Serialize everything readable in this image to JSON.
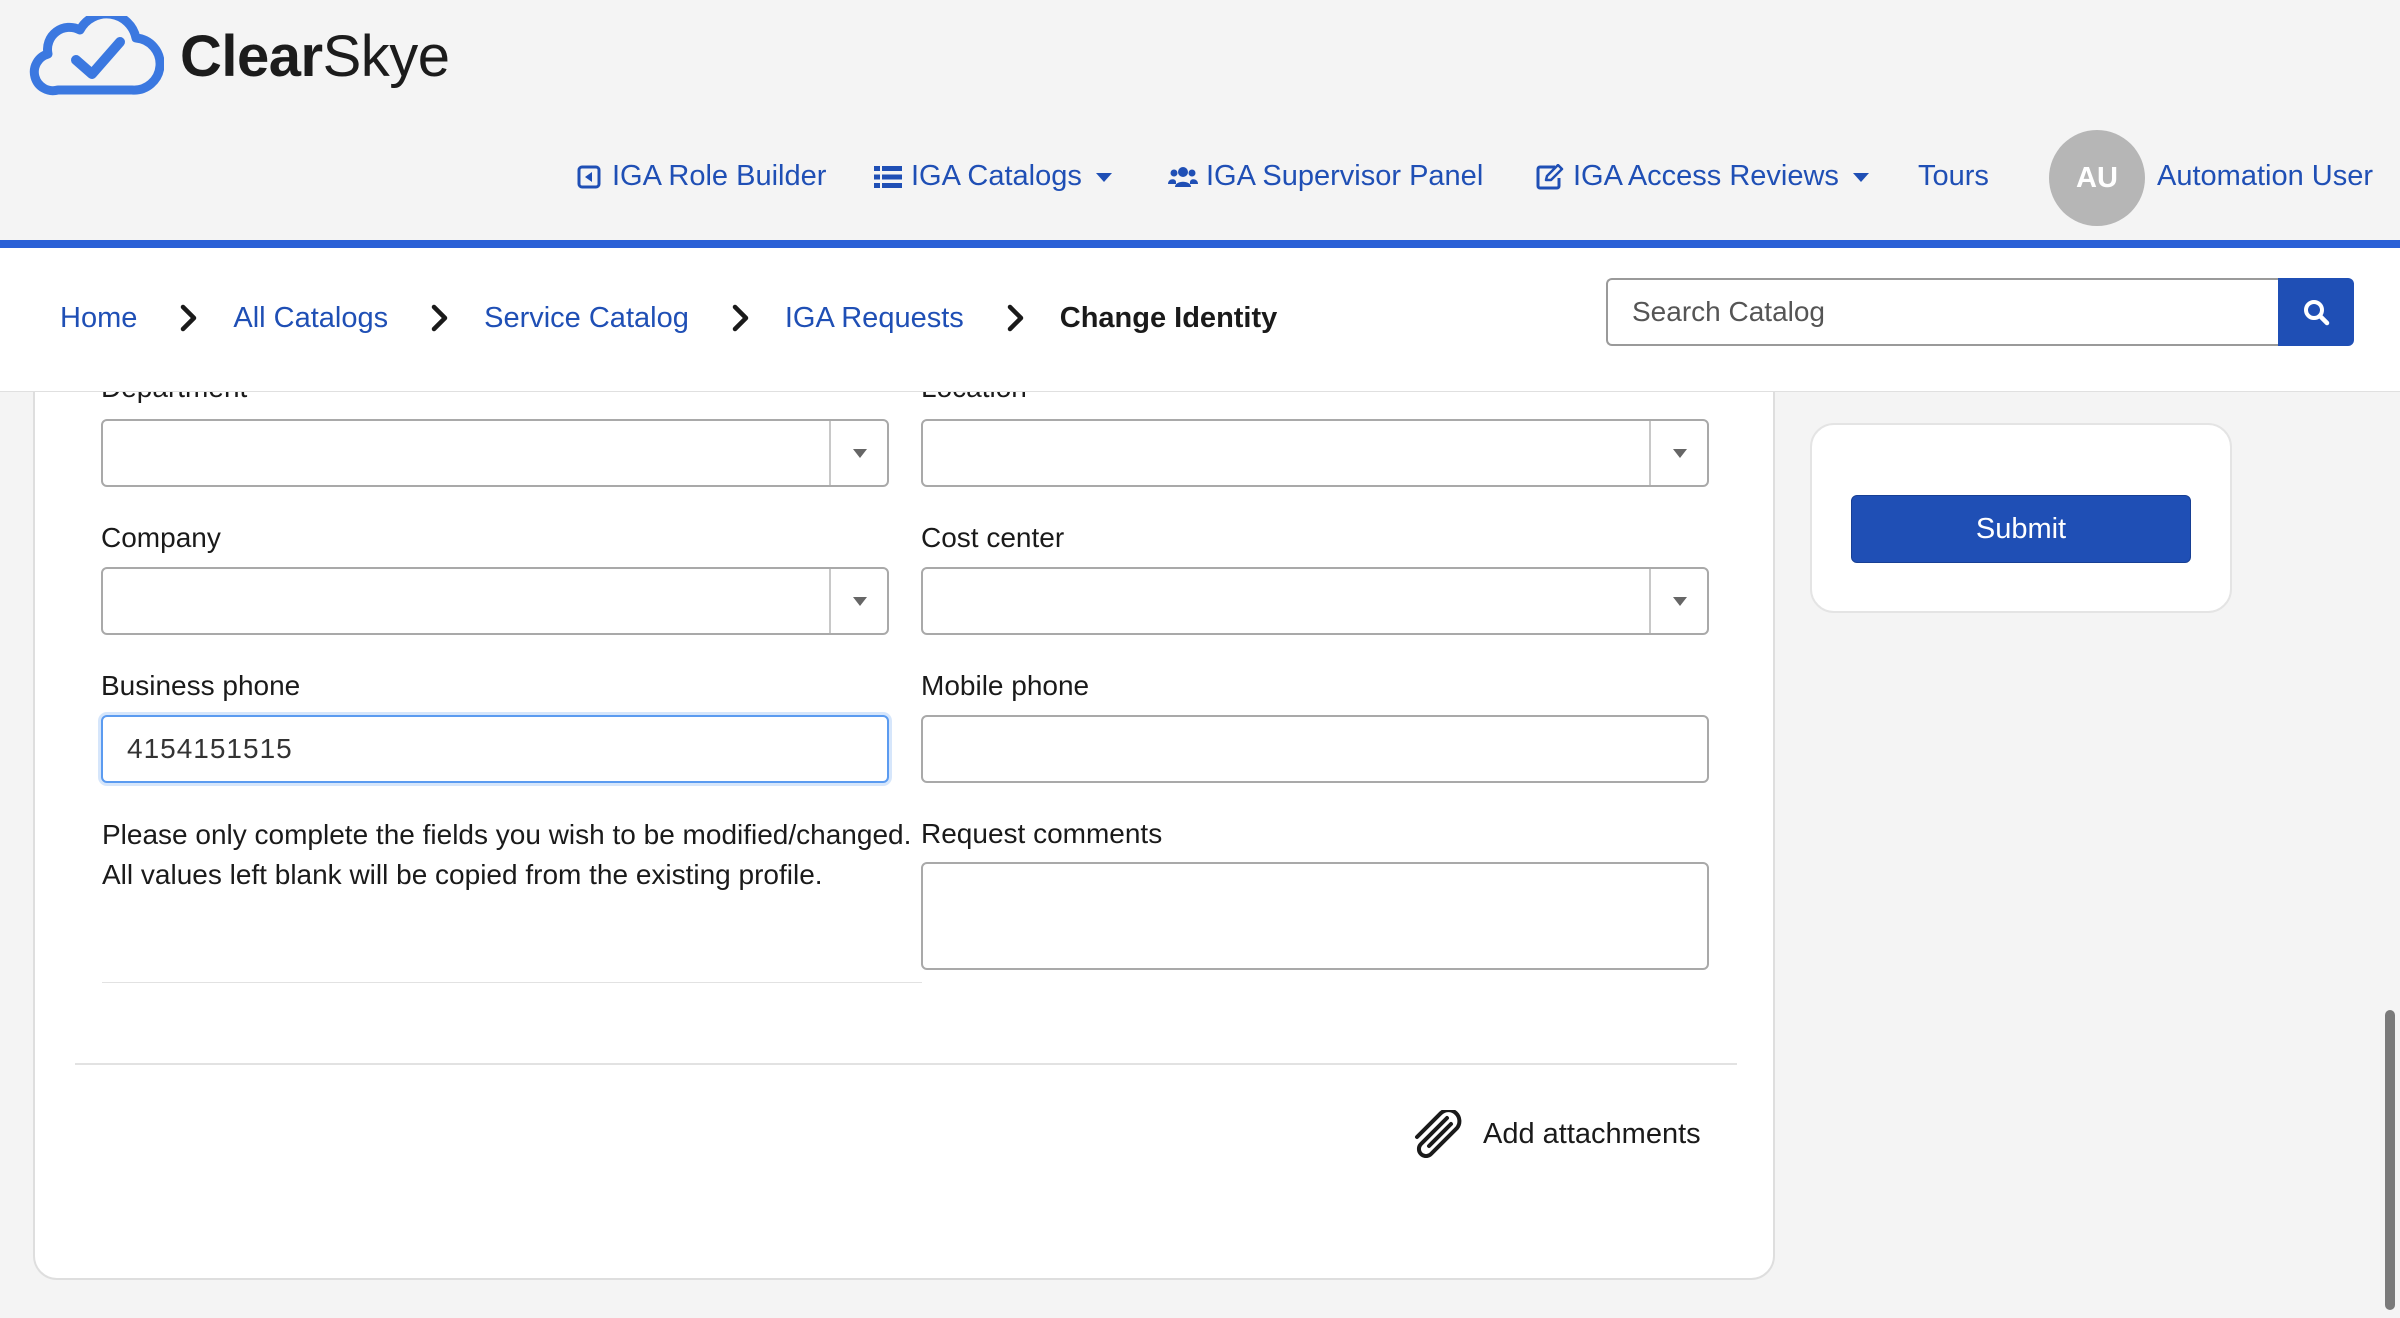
{
  "brand": {
    "name_bold": "Clear",
    "name_light": "Skye",
    "accent_color": "#2a60d6",
    "link_color": "#1f4fb5"
  },
  "nav": {
    "role_builder": {
      "label": "IGA Role Builder",
      "icon": "caret-square-left-icon"
    },
    "catalogs": {
      "label": "IGA Catalogs",
      "icon": "list-icon"
    },
    "supervisor": {
      "label": "IGA Supervisor Panel",
      "icon": "users-icon"
    },
    "access_reviews": {
      "label": "IGA Access Reviews",
      "icon": "edit-icon"
    },
    "tours": {
      "label": "Tours"
    },
    "user": {
      "initials": "AU",
      "name": "Automation User"
    }
  },
  "breadcrumb": {
    "items": [
      "Home",
      "All Catalogs",
      "Service Catalog",
      "IGA Requests"
    ],
    "current": "Change Identity"
  },
  "search": {
    "placeholder": "Search Catalog",
    "value": ""
  },
  "form": {
    "department": {
      "label": "Department",
      "value": ""
    },
    "location": {
      "label": "Location",
      "value": ""
    },
    "company": {
      "label": "Company",
      "value": ""
    },
    "cost_center": {
      "label": "Cost center",
      "value": ""
    },
    "business_phone": {
      "label": "Business phone",
      "value": "4154151515"
    },
    "mobile_phone": {
      "label": "Mobile phone",
      "value": ""
    },
    "help_text": "Please only complete the fields you wish to be modified/changed. All values left blank will be copied from the existing profile.",
    "request_comments": {
      "label": "Request comments",
      "value": ""
    },
    "attachments_label": "Add attachments"
  },
  "sidebar": {
    "submit_label": "Submit"
  }
}
